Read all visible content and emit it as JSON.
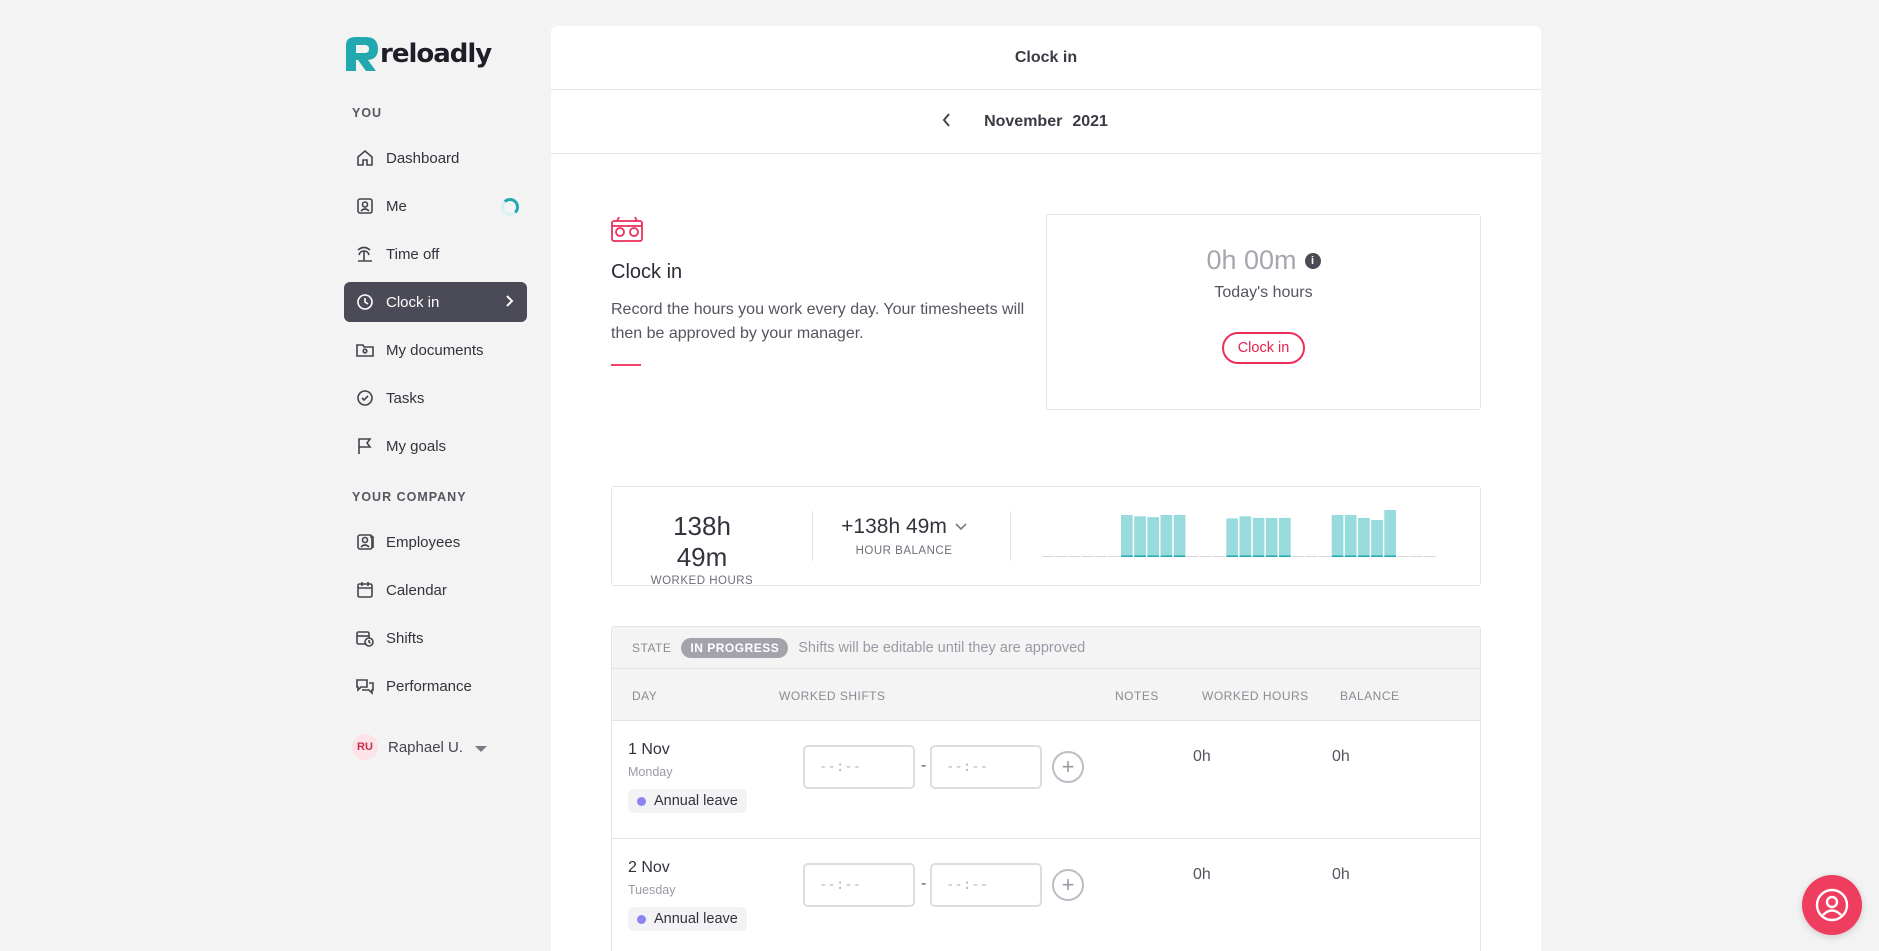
{
  "brand": {
    "name": "reloadly"
  },
  "sidebar": {
    "section_you": "YOU",
    "section_company": "YOUR COMPANY",
    "items": [
      {
        "label": "Dashboard",
        "icon": "home-icon"
      },
      {
        "label": "Me",
        "icon": "user-card-icon"
      },
      {
        "label": "Time off",
        "icon": "palm-tree-icon"
      },
      {
        "label": "Clock in",
        "icon": "clock-icon"
      },
      {
        "label": "My documents",
        "icon": "folder-user-icon"
      },
      {
        "label": "Tasks",
        "icon": "check-circle-icon"
      },
      {
        "label": "My goals",
        "icon": "flag-icon"
      },
      {
        "label": "Employees",
        "icon": "people-icon"
      },
      {
        "label": "Calendar",
        "icon": "calendar-icon"
      },
      {
        "label": "Shifts",
        "icon": "shift-calendar-icon"
      },
      {
        "label": "Performance",
        "icon": "chat-bubbles-icon"
      }
    ],
    "active": "Clock in",
    "user": {
      "initials": "RU",
      "name": "Raphael U."
    }
  },
  "main": {
    "header_title": "Clock in",
    "month": "November",
    "year": "2021",
    "intro": {
      "title": "Clock in",
      "description": "Record the hours you work every day. Your timesheets will then be approved by your manager."
    },
    "today": {
      "hours": "0h 00m",
      "label": "Today's hours",
      "button": "Clock in"
    },
    "stats": {
      "worked_hours": "138h 49m",
      "worked_label": "WORKED HOURS",
      "balance": "+138h 49m",
      "balance_label": "HOUR BALANCE"
    },
    "chart_data": {
      "type": "bar",
      "values": [
        0,
        0,
        0,
        0,
        0,
        0,
        1,
        0.97,
        0.95,
        1,
        1,
        0,
        0,
        0,
        0.92,
        0.97,
        0.93,
        0.93,
        0.93,
        0,
        0,
        0,
        1,
        1,
        0.93,
        0.88,
        1.12,
        0,
        0,
        0
      ],
      "accent": "#97dbdd"
    },
    "table": {
      "state_label": "STATE",
      "state_value": "IN PROGRESS",
      "state_note": "Shifts will be editable until they are approved",
      "columns": [
        "DAY",
        "WORKED SHIFTS",
        "NOTES",
        "WORKED HOURS",
        "BALANCE"
      ],
      "time_placeholder": "--:--",
      "rows": [
        {
          "date": "1 Nov",
          "weekday": "Monday",
          "badge": "Annual leave",
          "worked": "0h",
          "balance": "0h"
        },
        {
          "date": "2 Nov",
          "weekday": "Tuesday",
          "badge": "Annual leave",
          "worked": "0h",
          "balance": "0h"
        }
      ]
    }
  },
  "colors": {
    "accent_red": "#ec2f5a",
    "teal": "#22a9b0",
    "dark_nav": "#4b4b57"
  }
}
